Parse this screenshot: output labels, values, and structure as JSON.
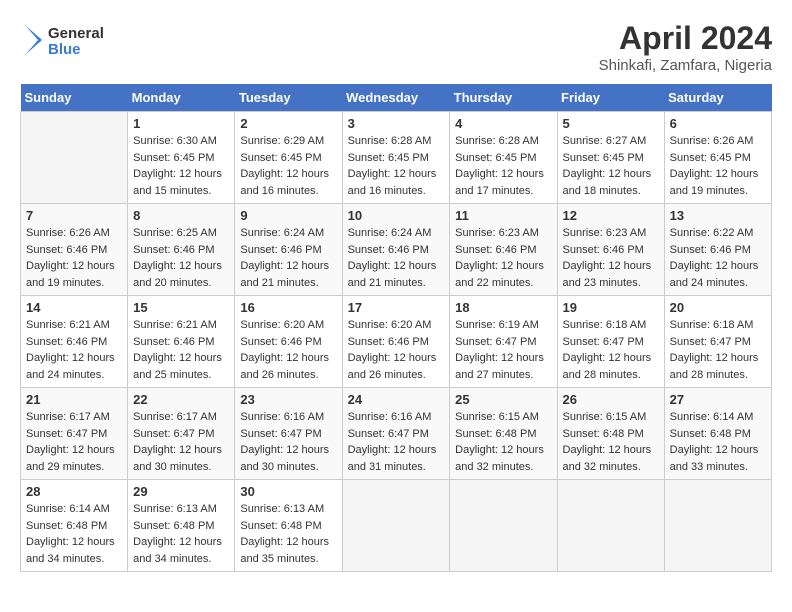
{
  "header": {
    "logo_general": "General",
    "logo_blue": "Blue",
    "title": "April 2024",
    "subtitle": "Shinkafi, Zamfara, Nigeria"
  },
  "calendar": {
    "days_of_week": [
      "Sunday",
      "Monday",
      "Tuesday",
      "Wednesday",
      "Thursday",
      "Friday",
      "Saturday"
    ],
    "weeks": [
      [
        {
          "day": "",
          "info": ""
        },
        {
          "day": "1",
          "info": "Sunrise: 6:30 AM\nSunset: 6:45 PM\nDaylight: 12 hours\nand 15 minutes."
        },
        {
          "day": "2",
          "info": "Sunrise: 6:29 AM\nSunset: 6:45 PM\nDaylight: 12 hours\nand 16 minutes."
        },
        {
          "day": "3",
          "info": "Sunrise: 6:28 AM\nSunset: 6:45 PM\nDaylight: 12 hours\nand 16 minutes."
        },
        {
          "day": "4",
          "info": "Sunrise: 6:28 AM\nSunset: 6:45 PM\nDaylight: 12 hours\nand 17 minutes."
        },
        {
          "day": "5",
          "info": "Sunrise: 6:27 AM\nSunset: 6:45 PM\nDaylight: 12 hours\nand 18 minutes."
        },
        {
          "day": "6",
          "info": "Sunrise: 6:26 AM\nSunset: 6:45 PM\nDaylight: 12 hours\nand 19 minutes."
        }
      ],
      [
        {
          "day": "7",
          "info": "Sunrise: 6:26 AM\nSunset: 6:46 PM\nDaylight: 12 hours\nand 19 minutes."
        },
        {
          "day": "8",
          "info": "Sunrise: 6:25 AM\nSunset: 6:46 PM\nDaylight: 12 hours\nand 20 minutes."
        },
        {
          "day": "9",
          "info": "Sunrise: 6:24 AM\nSunset: 6:46 PM\nDaylight: 12 hours\nand 21 minutes."
        },
        {
          "day": "10",
          "info": "Sunrise: 6:24 AM\nSunset: 6:46 PM\nDaylight: 12 hours\nand 21 minutes."
        },
        {
          "day": "11",
          "info": "Sunrise: 6:23 AM\nSunset: 6:46 PM\nDaylight: 12 hours\nand 22 minutes."
        },
        {
          "day": "12",
          "info": "Sunrise: 6:23 AM\nSunset: 6:46 PM\nDaylight: 12 hours\nand 23 minutes."
        },
        {
          "day": "13",
          "info": "Sunrise: 6:22 AM\nSunset: 6:46 PM\nDaylight: 12 hours\nand 24 minutes."
        }
      ],
      [
        {
          "day": "14",
          "info": "Sunrise: 6:21 AM\nSunset: 6:46 PM\nDaylight: 12 hours\nand 24 minutes."
        },
        {
          "day": "15",
          "info": "Sunrise: 6:21 AM\nSunset: 6:46 PM\nDaylight: 12 hours\nand 25 minutes."
        },
        {
          "day": "16",
          "info": "Sunrise: 6:20 AM\nSunset: 6:46 PM\nDaylight: 12 hours\nand 26 minutes."
        },
        {
          "day": "17",
          "info": "Sunrise: 6:20 AM\nSunset: 6:46 PM\nDaylight: 12 hours\nand 26 minutes."
        },
        {
          "day": "18",
          "info": "Sunrise: 6:19 AM\nSunset: 6:47 PM\nDaylight: 12 hours\nand 27 minutes."
        },
        {
          "day": "19",
          "info": "Sunrise: 6:18 AM\nSunset: 6:47 PM\nDaylight: 12 hours\nand 28 minutes."
        },
        {
          "day": "20",
          "info": "Sunrise: 6:18 AM\nSunset: 6:47 PM\nDaylight: 12 hours\nand 28 minutes."
        }
      ],
      [
        {
          "day": "21",
          "info": "Sunrise: 6:17 AM\nSunset: 6:47 PM\nDaylight: 12 hours\nand 29 minutes."
        },
        {
          "day": "22",
          "info": "Sunrise: 6:17 AM\nSunset: 6:47 PM\nDaylight: 12 hours\nand 30 minutes."
        },
        {
          "day": "23",
          "info": "Sunrise: 6:16 AM\nSunset: 6:47 PM\nDaylight: 12 hours\nand 30 minutes."
        },
        {
          "day": "24",
          "info": "Sunrise: 6:16 AM\nSunset: 6:47 PM\nDaylight: 12 hours\nand 31 minutes."
        },
        {
          "day": "25",
          "info": "Sunrise: 6:15 AM\nSunset: 6:48 PM\nDaylight: 12 hours\nand 32 minutes."
        },
        {
          "day": "26",
          "info": "Sunrise: 6:15 AM\nSunset: 6:48 PM\nDaylight: 12 hours\nand 32 minutes."
        },
        {
          "day": "27",
          "info": "Sunrise: 6:14 AM\nSunset: 6:48 PM\nDaylight: 12 hours\nand 33 minutes."
        }
      ],
      [
        {
          "day": "28",
          "info": "Sunrise: 6:14 AM\nSunset: 6:48 PM\nDaylight: 12 hours\nand 34 minutes."
        },
        {
          "day": "29",
          "info": "Sunrise: 6:13 AM\nSunset: 6:48 PM\nDaylight: 12 hours\nand 34 minutes."
        },
        {
          "day": "30",
          "info": "Sunrise: 6:13 AM\nSunset: 6:48 PM\nDaylight: 12 hours\nand 35 minutes."
        },
        {
          "day": "",
          "info": ""
        },
        {
          "day": "",
          "info": ""
        },
        {
          "day": "",
          "info": ""
        },
        {
          "day": "",
          "info": ""
        }
      ]
    ]
  }
}
